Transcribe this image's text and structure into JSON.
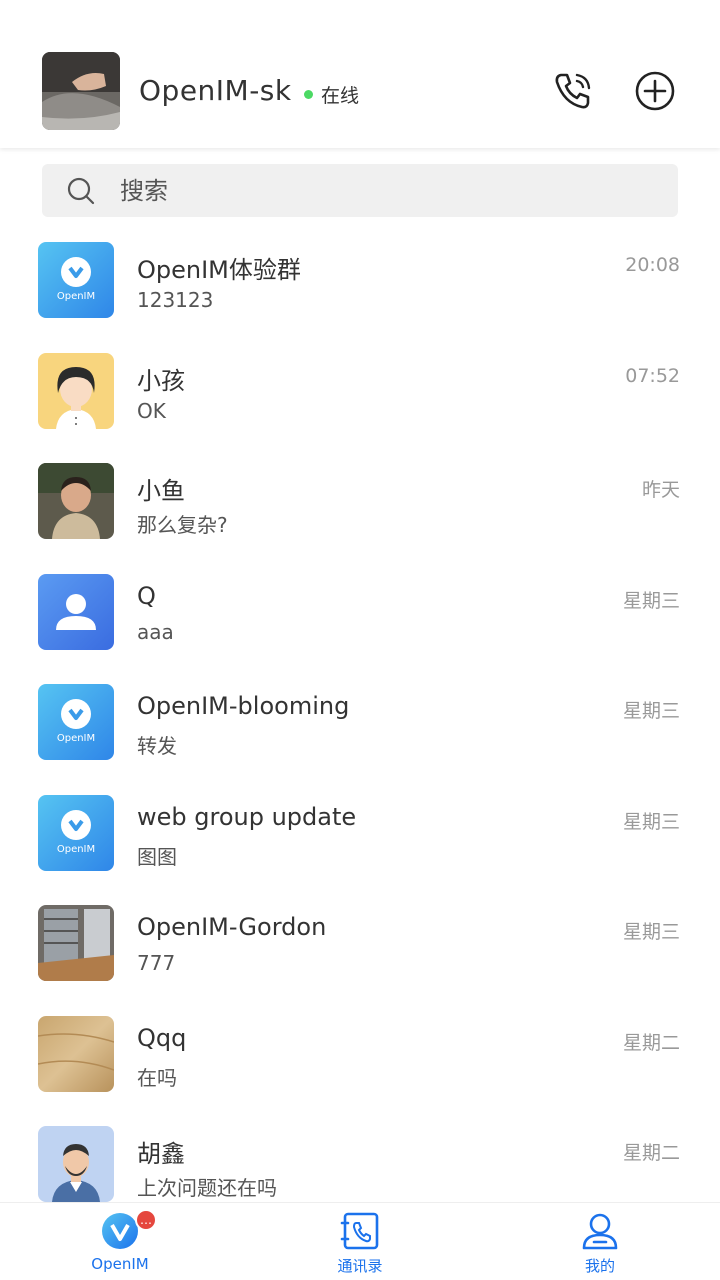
{
  "header": {
    "name": "OpenIM-sk",
    "status": "在线",
    "colors": {
      "online": "#4CD964"
    }
  },
  "search": {
    "placeholder": "搜索"
  },
  "conversations": [
    {
      "title": "OpenIM体验群",
      "message": "123123",
      "time": "20:08",
      "avatar": "openim-logo"
    },
    {
      "title": "小孩",
      "message": "OK",
      "time": "07:52",
      "avatar": "girl-cartoon"
    },
    {
      "title": "小鱼",
      "message": "那么复杂?",
      "time": "昨天",
      "avatar": "child-photo"
    },
    {
      "title": "Q",
      "message": "aaa",
      "time": "星期三",
      "avatar": "default-user"
    },
    {
      "title": "OpenIM-blooming",
      "message": "转发",
      "time": "星期三",
      "avatar": "openim-logo"
    },
    {
      "title": "web group update",
      "message": "图图",
      "time": "星期三",
      "avatar": "openim-logo"
    },
    {
      "title": "OpenIM-Gordon",
      "message": "777",
      "time": "星期三",
      "avatar": "room-photo"
    },
    {
      "title": "Qqq",
      "message": "在吗",
      "time": "星期二",
      "avatar": "wood-photo"
    },
    {
      "title": "胡鑫",
      "message": "上次问题还在吗",
      "time": "星期二",
      "avatar": "man-cartoon"
    }
  ],
  "tabbar": {
    "tabs": [
      {
        "label": "OpenIM",
        "icon": "openim-icon",
        "badge": "…"
      },
      {
        "label": "通讯录",
        "icon": "contacts-icon"
      },
      {
        "label": "我的",
        "icon": "profile-icon"
      }
    ],
    "colors": {
      "active": "#1B72EC",
      "badge": "#E5473E"
    }
  }
}
